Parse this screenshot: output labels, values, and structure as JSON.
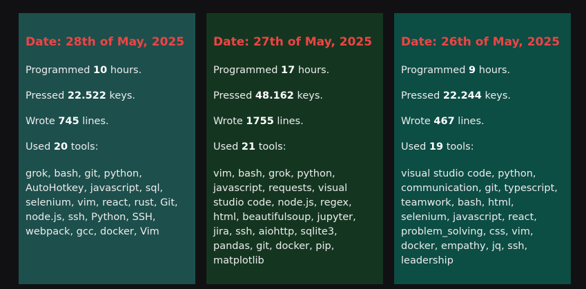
{
  "cards": [
    {
      "date": "Date: 28th of May, 2025",
      "programmed": {
        "prefix": "Programmed ",
        "value": "10",
        "suffix": " hours."
      },
      "pressed": {
        "prefix": "Pressed ",
        "value": "22.522",
        "suffix": " keys."
      },
      "wrote": {
        "prefix": "Wrote ",
        "value": "745",
        "suffix": " lines."
      },
      "used": {
        "prefix": "Used ",
        "value": "20",
        "suffix": " tools:"
      },
      "tools": "grok, bash, git, python, AutoHotkey, javascript, sql, selenium, vim, react, rust, Git, node.js, ssh, Python, SSH, webpack, gcc, docker, Vim"
    },
    {
      "date": "Date: 27th of May, 2025",
      "programmed": {
        "prefix": "Programmed ",
        "value": "17",
        "suffix": " hours."
      },
      "pressed": {
        "prefix": "Pressed ",
        "value": "48.162",
        "suffix": " keys."
      },
      "wrote": {
        "prefix": "Wrote ",
        "value": "1755",
        "suffix": " lines."
      },
      "used": {
        "prefix": "Used ",
        "value": "21",
        "suffix": " tools:"
      },
      "tools": "vim, bash, grok, python, javascript, requests, visual studio code, node.js, regex, html, beautifulsoup, jupyter, jira, ssh, aiohttp, sqlite3, pandas, git, docker, pip, matplotlib"
    },
    {
      "date": "Date: 26th of May, 2025",
      "programmed": {
        "prefix": "Programmed ",
        "value": "9",
        "suffix": " hours."
      },
      "pressed": {
        "prefix": "Pressed ",
        "value": "22.244",
        "suffix": " keys."
      },
      "wrote": {
        "prefix": "Wrote ",
        "value": "467",
        "suffix": " lines."
      },
      "used": {
        "prefix": "Used ",
        "value": "19",
        "suffix": " tools:"
      },
      "tools": "visual studio code, python, communication, git, typescript, teamwork, bash, html, selenium, javascript, react, problem_solving, css, vim, docker, empathy, jq, ssh, leadership"
    }
  ],
  "colors": {
    "background": "#111113",
    "date_text": "#ef4444",
    "card_1": "#1d4f4c",
    "card_2": "#143620",
    "card_3": "#0c4d44"
  }
}
